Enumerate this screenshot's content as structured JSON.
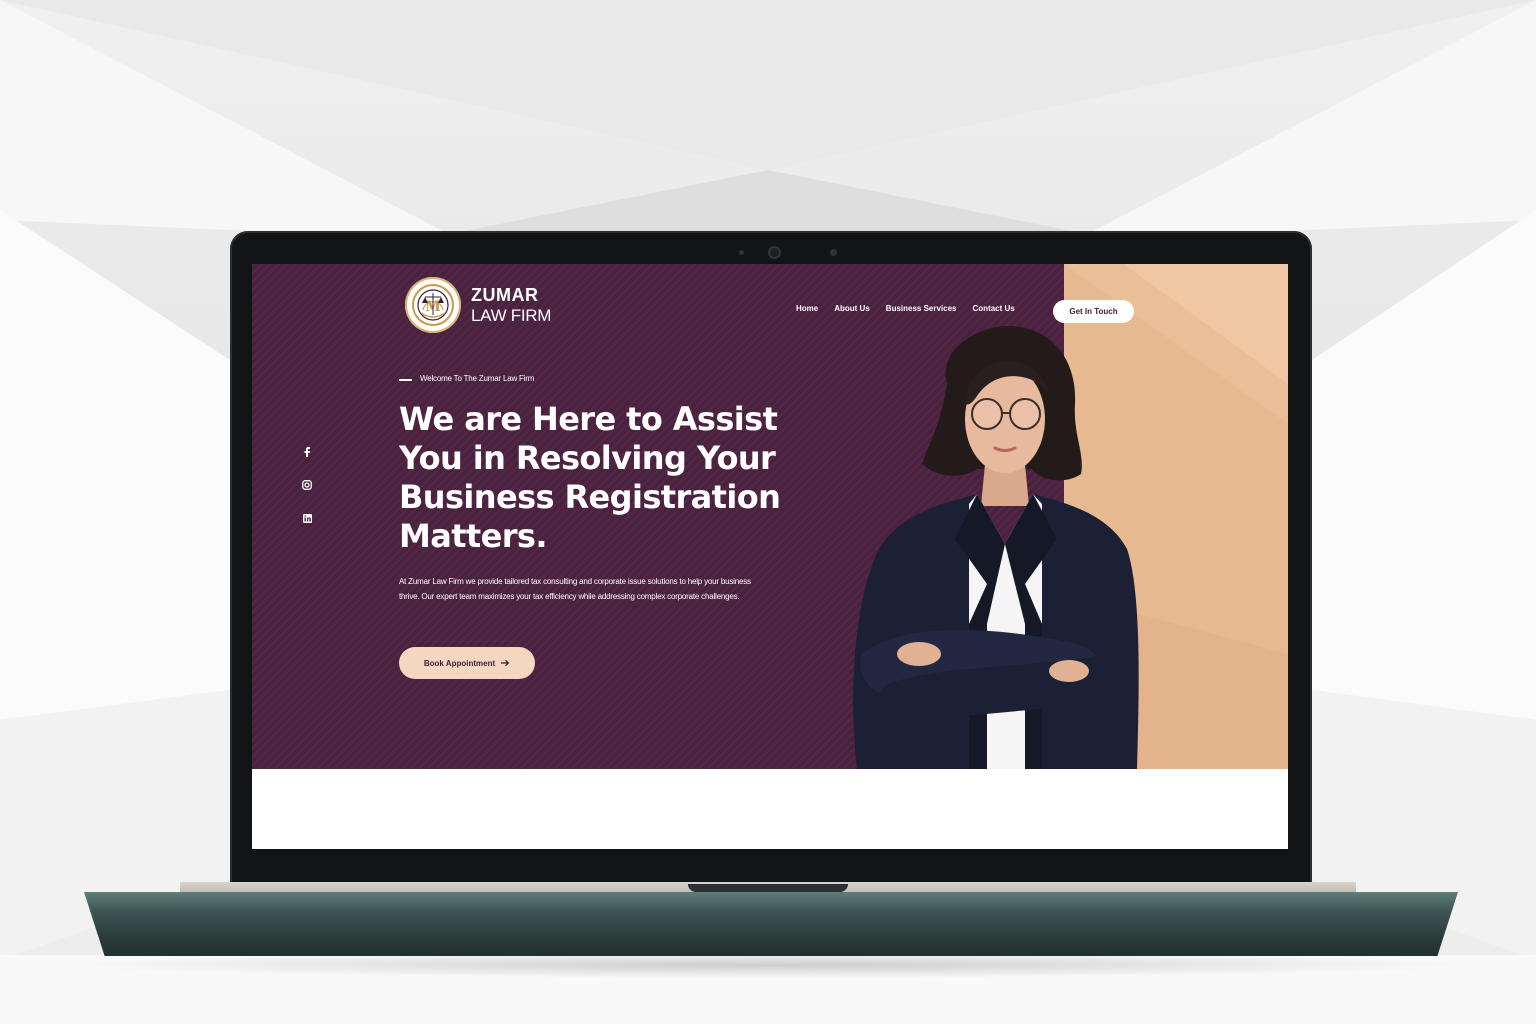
{
  "site": {
    "logo_line1": "ZUMAR",
    "logo_line2": "LAW FIRM"
  },
  "nav": {
    "items": [
      "Home",
      "About Us",
      "Business Services",
      "Contact Us"
    ],
    "cta": "Get In Touch"
  },
  "hero": {
    "eyebrow": "Welcome To The Zumar Law Firm",
    "headline": "We are Here to Assist You in Resolving Your Business Registration Matters.",
    "description": "At Zumar Law Firm we provide tailored tax consulting and corporate issue solutions to help your business thrive. Our expert team maximizes your tax efficiency while addressing complex corporate challenges.",
    "cta": "Book Appointment"
  },
  "social": [
    "facebook-icon",
    "instagram-icon",
    "linkedin-icon"
  ],
  "colors": {
    "brand_purple": "#4b2140",
    "accent_peach": "#eabf97",
    "button_peach": "#f3d7c0",
    "laptop_base": "#2f4443"
  }
}
